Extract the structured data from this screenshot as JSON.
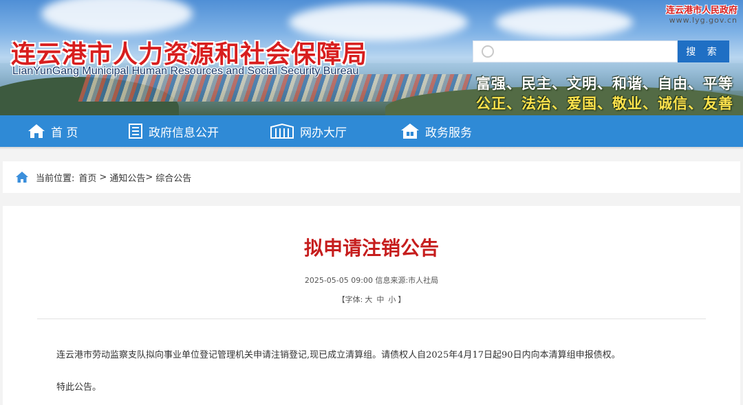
{
  "header": {
    "site_title": "连云港市人力资源和社会保障局",
    "site_subtitle": "LianYunGang Municipal Human Resources and Social Security Bureau",
    "gov_name": "连云港市人民政府",
    "gov_url": "www.lyg.gov.cn",
    "search": {
      "placeholder": "",
      "button_label": "搜 索"
    },
    "core_values": {
      "line1": "富强、民主、文明、和谐、自由、平等",
      "line2": "公正、法治、爱国、敬业、诚信、友善"
    },
    "accent_red": "#d81e1e"
  },
  "nav": {
    "color": "#2f8ad6",
    "items": [
      {
        "label": "首 页",
        "icon": "home-icon"
      },
      {
        "label": "政府信息公开",
        "icon": "document-icon"
      },
      {
        "label": "网办大厅",
        "icon": "building-icon"
      },
      {
        "label": "政务服务",
        "icon": "service-icon"
      }
    ]
  },
  "breadcrumb": {
    "prefix": "当前位置:",
    "items": [
      "首页",
      "通知公告",
      "综合公告"
    ],
    "separator": ">"
  },
  "article": {
    "title": "拟申请注销公告",
    "date": "2025-05-05 09:00",
    "source": "信息来源:市人社局",
    "font_size_label": "【字体:",
    "font_size_options": [
      "大",
      "中",
      "小"
    ],
    "font_size_close": "】",
    "paragraphs": [
      "连云港市劳动监察支队拟向事业单位登记管理机关申请注销登记,现已成立清算组。请债权人自2025年4月17日起90日内向本清算组申报债权。",
      "特此公告。"
    ]
  }
}
